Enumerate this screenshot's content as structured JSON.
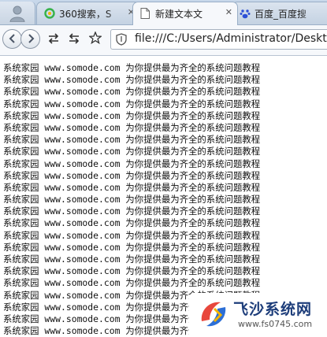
{
  "tabs": [
    {
      "label": "360搜索，S",
      "icon": "360-search-icon",
      "active": false
    },
    {
      "label": "新建文本文",
      "icon": "document-icon",
      "active": true
    },
    {
      "label": "百度_百度搜",
      "icon": "baidu-paw-icon",
      "active": false
    }
  ],
  "toolbar": {
    "back_icon": "back-arrow-icon",
    "forward_icon": "forward-arrow-icon",
    "url": "file:///C:/Users/Administrator/Deskto"
  },
  "content": {
    "lines": [
      "系统家园 www.somode.com 为你提供最为齐全的系统问题教程",
      "系统家园 www.somode.com 为你提供最为齐全的系统问题教程",
      "系统家园 www.somode.com 为你提供最为齐全的系统问题教程",
      "系统家园 www.somode.com 为你提供最为齐全的系统问题教程",
      "系统家园 www.somode.com 为你提供最为齐全的系统问题教程",
      "系统家园 www.somode.com 为你提供最为齐全的系统问题教程",
      "系统家园 www.somode.com 为你提供最为齐全的系统问题教程",
      "系统家园 www.somode.com 为你提供最为齐全的系统问题教程",
      "系统家园 www.somode.com 为你提供最为齐全的系统问题教程",
      "系统家园 www.somode.com 为你提供最为齐全的系统问题教程",
      "系统家园 www.somode.com 为你提供最为齐全的系统问题教程",
      "系统家园 www.somode.com 为你提供最为齐全的系统问题教程",
      "系统家园 www.somode.com 为你提供最为齐全的系统问题教程",
      "系统家园 www.somode.com 为你提供最为齐全的系统问题教程",
      "系统家园 www.somode.com 为你提供最为齐全的系统问题教程",
      "系统家园 www.somode.com 为你提供最为齐全的系统问题教程",
      "系统家园 www.somode.com 为你提供最为齐全的系统问题教程",
      "系统家园 www.somode.com 为你提供最为齐全的系统问题教程",
      "系统家园 www.somode.com 为你提供最为齐全的系统问题教程",
      "系统家园 www.somode.com 为你提供最为齐全的系统问题教程",
      "系统家园 www.somode.com 为你提供最为齐全的系统问题教程",
      "系统家园 www.somode.com 为你提供最为齐全的系统问题教程",
      "系统家园 www.somode.com 为你提供最为齐全的系统问题教程"
    ]
  },
  "watermark": {
    "name": "飞沙系统网",
    "url": "www.fs0745.com",
    "logo_icon": "fs-logo-icon"
  },
  "colors": {
    "tab_strip": "#c3d3e6",
    "toolbar": "#f6f8fb",
    "watermark_name": "#1d3d7a",
    "logo_red": "#e8473c",
    "logo_blue": "#2d6fd6"
  }
}
